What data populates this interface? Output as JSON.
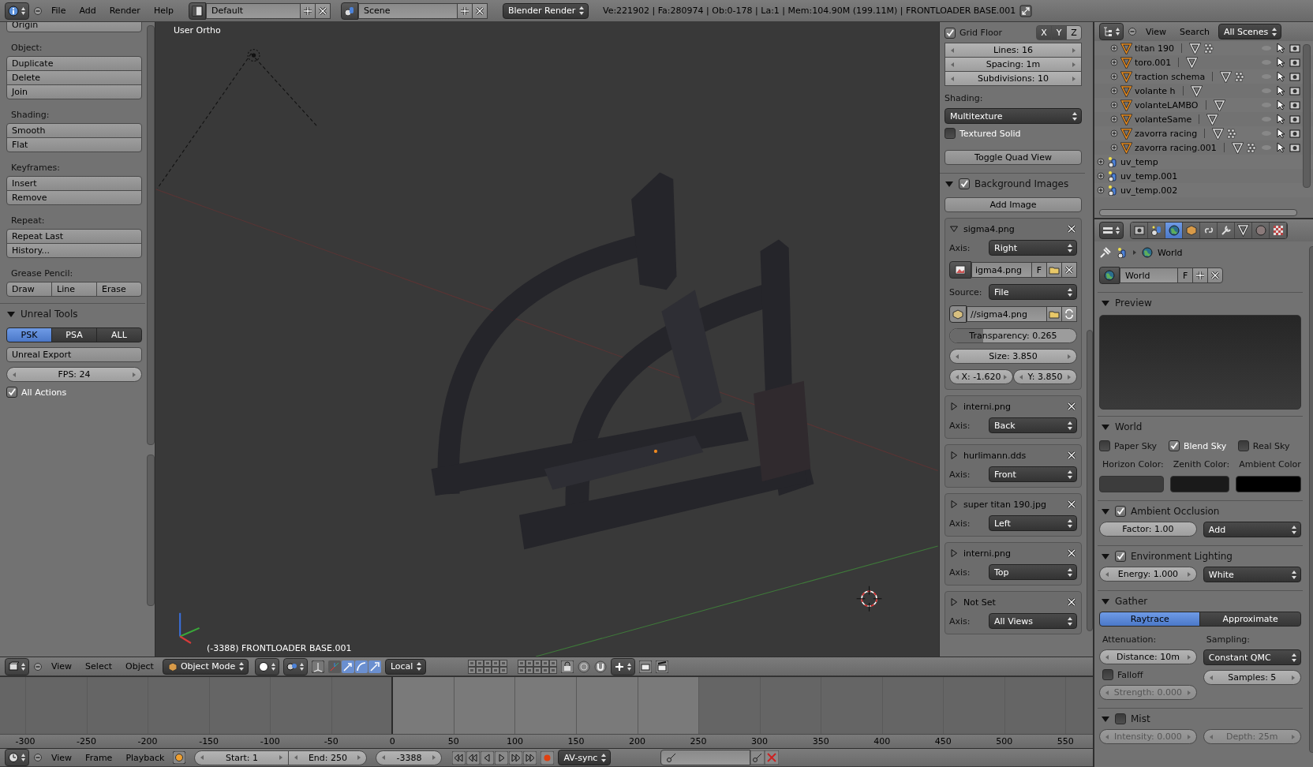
{
  "header": {
    "menus": [
      "File",
      "Add",
      "Render",
      "Help"
    ],
    "layout": "Default",
    "scene": "Scene",
    "engine": "Blender Render",
    "stats": "Ve:221902 | Fa:280974 | Ob:0-178 | La:1 | Mem:104.90M (199.11M) | FRONTLOADER BASE.001"
  },
  "tool_shelf": {
    "groups": [
      {
        "kind": "column",
        "buttons": [
          "Origin"
        ]
      },
      {
        "kind": "column",
        "label": "Object:",
        "buttons": [
          "Duplicate",
          "Delete",
          "Join"
        ]
      },
      {
        "kind": "column",
        "label": "Shading:",
        "buttons": [
          "Smooth",
          "Flat"
        ]
      },
      {
        "kind": "column",
        "label": "Keyframes:",
        "buttons": [
          "Insert",
          "Remove"
        ]
      },
      {
        "kind": "column",
        "label": "Repeat:",
        "buttons": [
          "Repeat Last",
          "History..."
        ]
      },
      {
        "kind": "row",
        "label": "Grease Pencil:",
        "buttons": [
          "Draw",
          "Line",
          "Erase"
        ]
      }
    ],
    "unreal_tools": {
      "title": "Unreal Tools",
      "expanded": true,
      "formats": [
        {
          "label": "PSK",
          "selected": true
        },
        {
          "label": "PSA",
          "selected": false
        },
        {
          "label": "ALL",
          "selected": false
        }
      ],
      "export": "Unreal Export",
      "fps": "FPS: 24",
      "all_actions": {
        "label": "All Actions",
        "checked": true
      }
    }
  },
  "viewport": {
    "view_name": "User Ortho",
    "object_info": "(-3388) FRONTLOADER BASE.001"
  },
  "view_panel": {
    "grid_floor": {
      "label": "Grid Floor",
      "checked": true,
      "axes": [
        {
          "label": "X",
          "selected": false
        },
        {
          "label": "Y",
          "selected": false
        },
        {
          "label": "Z",
          "selected": true
        }
      ]
    },
    "grid_fields": [
      "Lines: 16",
      "Spacing: 1m",
      "Subdivisions: 10"
    ],
    "shading_label": "Shading:",
    "shading": "Multitexture",
    "textured_solid": {
      "label": "Textured Solid",
      "checked": false
    },
    "quad_view": "Toggle Quad View",
    "background_images": {
      "title": "Background Images",
      "checked": true,
      "expanded": true,
      "add": "Add Image",
      "images": [
        {
          "name": "sigma4.png",
          "expanded": true,
          "axis_label": "Axis:",
          "axis": "Right",
          "image": "igma4.png",
          "fake_user": "F",
          "source_label": "Source:",
          "source": "File",
          "path": "//sigma4.png",
          "transparency": "Transparency: 0.265",
          "level": 0.265,
          "size": "Size: 3.850",
          "x": "X: -1.620",
          "y": "Y: 3.850"
        },
        {
          "name": "interni.png",
          "expanded": false,
          "axis_label": "Axis:",
          "axis": "Back"
        },
        {
          "name": "hurlimann.dds",
          "expanded": false,
          "axis_label": "Axis:",
          "axis": "Front"
        },
        {
          "name": "super titan 190.jpg",
          "expanded": false,
          "axis_label": "Axis:",
          "axis": "Left"
        },
        {
          "name": "interni.png",
          "expanded": false,
          "axis_label": "Axis:",
          "axis": "Top"
        },
        {
          "name": "Not Set",
          "expanded": false,
          "axis_label": "Axis:",
          "axis": "All Views"
        }
      ]
    }
  },
  "view_header": {
    "menus": [
      "View",
      "Select",
      "Object"
    ],
    "mode": "Object Mode",
    "orientation": "Local"
  },
  "timeline": {
    "ruler": [
      "-300",
      "-250",
      "-200",
      "-150",
      "-100",
      "-50",
      "0",
      "50",
      "100",
      "150",
      "200",
      "250",
      "300",
      "350",
      "400",
      "450",
      "500",
      "550"
    ],
    "menus": [
      "View",
      "Frame",
      "Playback"
    ],
    "start": "Start: 1",
    "end": "End: 250",
    "current": "-3388",
    "sync": "AV-sync"
  },
  "outliner": {
    "menus": [
      "View",
      "Search"
    ],
    "filter": "All Scenes",
    "rows": [
      {
        "name": "titan 190",
        "kind": "mesh",
        "particles": true
      },
      {
        "name": "toro.001",
        "kind": "mesh",
        "particles": false
      },
      {
        "name": "traction schema",
        "kind": "mesh",
        "particles": true
      },
      {
        "name": "volante h",
        "kind": "mesh",
        "particles": false
      },
      {
        "name": "volanteLAMBO",
        "kind": "mesh",
        "particles": false
      },
      {
        "name": "volanteSame",
        "kind": "mesh",
        "particles": false
      },
      {
        "name": "zavorra  racing",
        "kind": "mesh",
        "particles": true
      },
      {
        "name": "zavorra  racing.001",
        "kind": "mesh",
        "particles": true
      },
      {
        "name": "uv_temp",
        "kind": "group"
      },
      {
        "name": "uv_temp.001",
        "kind": "group"
      },
      {
        "name": "uv_temp.002",
        "kind": "group"
      }
    ]
  },
  "properties": {
    "tabs": [
      {
        "kind": "render",
        "selected": false
      },
      {
        "kind": "scene",
        "selected": false
      },
      {
        "kind": "world",
        "selected": true
      },
      {
        "kind": "object",
        "selected": false
      },
      {
        "kind": "constraints",
        "selected": false
      },
      {
        "kind": "modifiers",
        "selected": false
      },
      {
        "kind": "data",
        "selected": false
      },
      {
        "kind": "material",
        "selected": false
      },
      {
        "kind": "texture",
        "selected": false
      }
    ],
    "breadcrumb": "World",
    "datablock": "World",
    "fake_user": "F",
    "preview": {
      "title": "Preview",
      "expanded": true
    },
    "world": {
      "title": "World",
      "expanded": true,
      "skies": [
        {
          "label": "Paper Sky",
          "checked": false
        },
        {
          "label": "Blend Sky",
          "checked": true
        },
        {
          "label": "Real Sky",
          "checked": false
        }
      ],
      "colors": [
        {
          "label": "Horizon Color:",
          "color": "#3c3c3c"
        },
        {
          "label": "Zenith Color:",
          "color": "#1a1a1a"
        },
        {
          "label": "Ambient Color",
          "color": "#000000"
        }
      ]
    },
    "ambient_occlusion": {
      "title": "Ambient Occlusion",
      "expanded": true,
      "checked": true,
      "factor": "Factor: 1.00",
      "blend": "Add"
    },
    "environment_lighting": {
      "title": "Environment Lighting",
      "expanded": true,
      "checked": true,
      "energy": "Energy: 1.000",
      "source": "White"
    },
    "gather": {
      "title": "Gather",
      "expanded": true,
      "methods": [
        {
          "label": "Raytrace",
          "selected": true
        },
        {
          "label": "Approximate",
          "selected": false
        }
      ],
      "attenuation_label": "Attenuation:",
      "distance": "Distance: 10m",
      "falloff": {
        "label": "Falloff",
        "checked": false
      },
      "strength": "Strength: 0.000",
      "sampling_label": "Sampling:",
      "sampling": "Constant QMC",
      "samples": "Samples: 5"
    },
    "mist": {
      "title": "Mist",
      "expanded": true,
      "checked": false,
      "intensity": "Intensity: 0.000",
      "depth": "Depth: 25m"
    }
  }
}
